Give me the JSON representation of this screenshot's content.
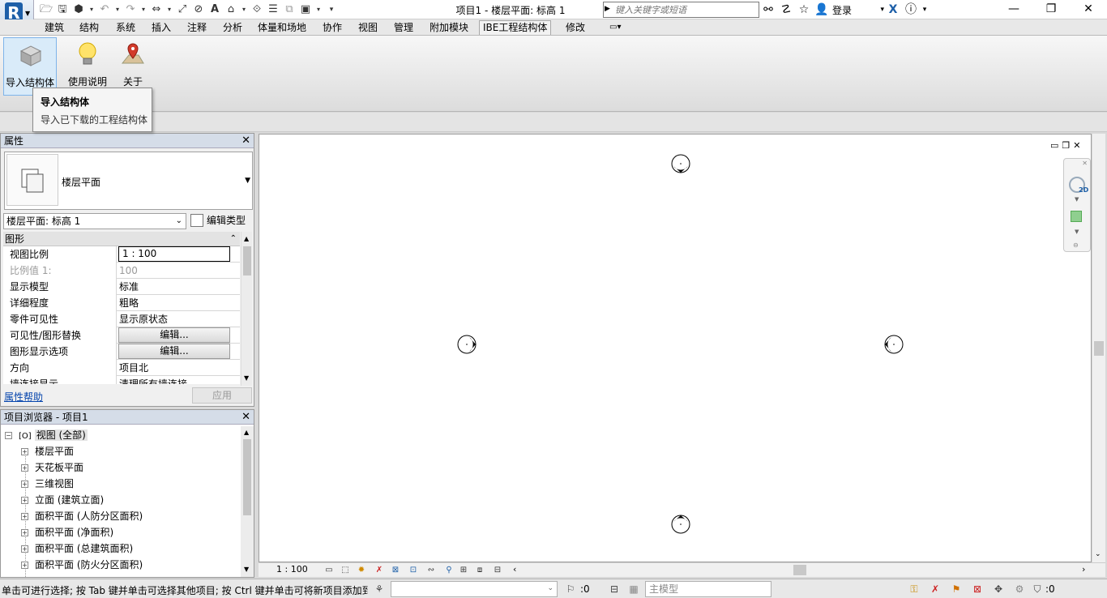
{
  "app": {
    "title": "项目1 - 楼层平面: 标高 1",
    "logo_letter": "R",
    "search_placeholder": "键入关键字或短语",
    "login_label": "登录"
  },
  "menu": {
    "tabs": [
      "建筑",
      "结构",
      "系统",
      "插入",
      "注释",
      "分析",
      "体量和场地",
      "协作",
      "视图",
      "管理",
      "附加模块",
      "IBE工程结构体",
      "修改"
    ],
    "active_tab": "IBE工程结构体"
  },
  "ribbon": {
    "buttons": [
      {
        "label": "导入结构体",
        "icon": "import-cube-icon"
      },
      {
        "label": "使用说明",
        "icon": "lightbulb-icon"
      },
      {
        "label": "关于",
        "icon": "map-pin-icon"
      }
    ],
    "tooltip": {
      "title": "导入结构体",
      "description": "导入已下载的工程结构体"
    }
  },
  "properties": {
    "header": "属性",
    "type_name": "楼层平面",
    "view_select": "楼层平面: 标高 1",
    "edit_type_label": "编辑类型",
    "group": "图形",
    "rows": [
      {
        "name": "视图比例",
        "value": "1 : 100"
      },
      {
        "name": "比例值 1:",
        "value": "100"
      },
      {
        "name": "显示模型",
        "value": "标准"
      },
      {
        "name": "详细程度",
        "value": "粗略"
      },
      {
        "name": "零件可见性",
        "value": "显示原状态"
      },
      {
        "name": "可见性/图形替换",
        "value": "编辑..."
      },
      {
        "name": "图形显示选项",
        "value": "编辑..."
      },
      {
        "name": "方向",
        "value": "项目北"
      },
      {
        "name": "墙连接显示",
        "value": "清理所有墙连接"
      }
    ],
    "help_link": "属性帮助",
    "apply_label": "应用"
  },
  "browser": {
    "header": "项目浏览器 - 项目1",
    "root": "视图 (全部)",
    "items": [
      "楼层平面",
      "天花板平面",
      "三维视图",
      "立面 (建筑立面)",
      "面积平面 (人防分区面积)",
      "面积平面 (净面积)",
      "面积平面 (总建筑面积)",
      "面积平面 (防火分区面积)"
    ]
  },
  "viewbar": {
    "scale": "1 : 100"
  },
  "status": {
    "text": "单击可进行选择; 按 Tab 键并单击可选择其他项目; 按 Ctrl 键并单击可将新项目添加到选择集; 按 Shift 键并单击可取消选择。",
    "selection_count": ":0",
    "model_placeholder": "主模型",
    "filter_count": ":0"
  },
  "colors": {
    "accent": "#1d5fa8",
    "link": "#0645ad"
  }
}
